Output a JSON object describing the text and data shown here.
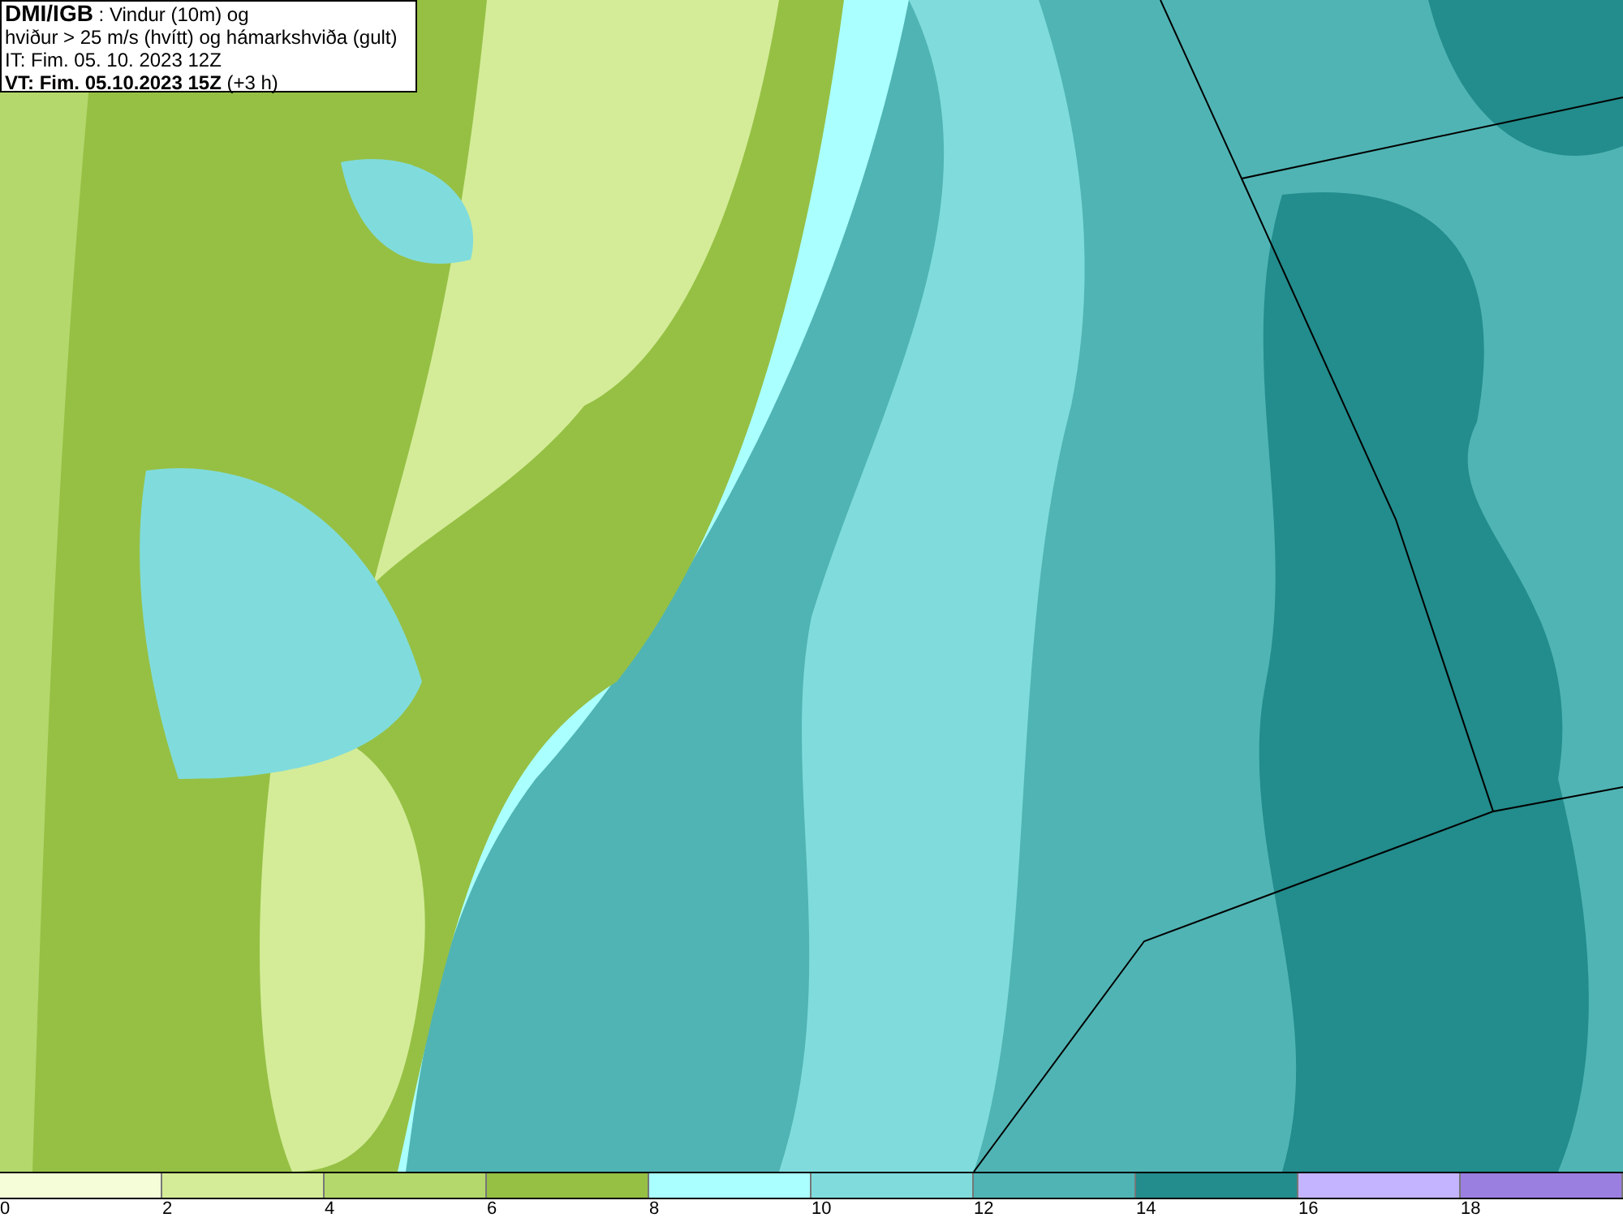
{
  "header": {
    "source": "DMI/IGB",
    "title": " : Vindur (10m) og",
    "subtitle": "hviður > 25 m/s (hvítt) og hámarkshviða (gult)",
    "initial_time": "IT: Fim. 05. 10. 2023 12Z",
    "valid_time": "VT: Fim. 05.10.2023 15Z",
    "offset": "(+3 h)"
  },
  "legend": {
    "bins": [
      {
        "color": "#f4fcd8"
      },
      {
        "color": "#d4ec98"
      },
      {
        "color": "#b4d86c"
      },
      {
        "color": "#96c044"
      },
      {
        "color": "#aaffff"
      },
      {
        "color": "#80dcdc"
      },
      {
        "color": "#50b4b4"
      },
      {
        "color": "#238c8c"
      },
      {
        "color": "#c4b4ff"
      },
      {
        "color": "#9a7fe0"
      }
    ],
    "ticks": [
      "0",
      "2",
      "4",
      "6",
      "8",
      "10",
      "12",
      "14",
      "16",
      "18"
    ]
  }
}
